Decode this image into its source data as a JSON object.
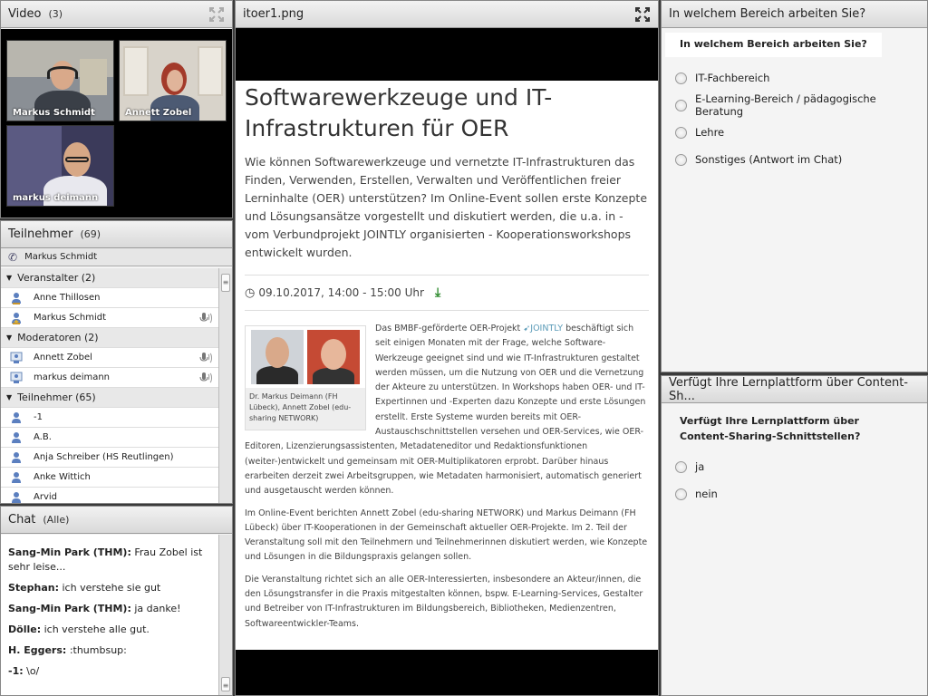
{
  "video": {
    "title": "Video",
    "count": "(3)",
    "tiles": [
      {
        "name": "Markus Schmidt"
      },
      {
        "name": "Annett Zobel"
      },
      {
        "name": "markus deimann"
      }
    ]
  },
  "participants": {
    "title": "Teilnehmer",
    "count": "(69)",
    "host": "Markus Schmidt",
    "rows": [
      {
        "type": "group",
        "label": "Veranstalter (2)"
      },
      {
        "type": "person",
        "label": "Anne Thillosen",
        "role": "host",
        "mic": false
      },
      {
        "type": "person",
        "label": "Markus Schmidt",
        "role": "host-star",
        "mic": true
      },
      {
        "type": "group",
        "label": "Moderatoren (2)"
      },
      {
        "type": "person",
        "label": "Annett Zobel",
        "role": "presenter",
        "mic": true
      },
      {
        "type": "person",
        "label": "markus deimann",
        "role": "presenter",
        "mic": true
      },
      {
        "type": "group",
        "label": "Teilnehmer (65)"
      },
      {
        "type": "person",
        "label": "-1",
        "role": "participant",
        "mic": false
      },
      {
        "type": "person",
        "label": "A.B.",
        "role": "participant",
        "mic": false
      },
      {
        "type": "person",
        "label": "Anja Schreiber (HS Reutlingen)",
        "role": "participant",
        "mic": false
      },
      {
        "type": "person",
        "label": "Anke Wittich",
        "role": "participant",
        "mic": false
      },
      {
        "type": "person",
        "label": "Arvid",
        "role": "participant",
        "mic": false
      }
    ]
  },
  "chat": {
    "title": "Chat",
    "scope": "(Alle)",
    "messages": [
      {
        "author": "Sang-Min Park (THM):",
        "text": "Frau Zobel ist sehr leise..."
      },
      {
        "author": "Stephan:",
        "text": "ich verstehe sie gut"
      },
      {
        "author": "Sang-Min Park (THM):",
        "text": "ja danke!"
      },
      {
        "author": "Dölle:",
        "text": "ich verstehe alle gut."
      },
      {
        "author": "H. Eggers:",
        "text": ":thumbsup:"
      },
      {
        "author": "-1:",
        "text": "\\o/"
      }
    ]
  },
  "share": {
    "filename": "itoer1.png",
    "title": "Softwarewerkzeuge und IT-Infrastrukturen für OER",
    "lead": "Wie können Softwarewerkzeuge und vernetzte IT-Infrastrukturen das Finden, Verwenden, Erstellen, Verwalten und Veröffentlichen freier Lerninhalte (OER) unterstützen? Im Online-Event sollen erste Konzepte und Lösungsansätze vorgestellt und diskutiert werden, die u.a. in - vom Verbundprojekt JOINTLY organisierten - Kooperationsworkshops entwickelt wurden.",
    "date": "09.10.2017, 14:00 - 15:00 Uhr",
    "photo_caption": "Dr. Markus Deimann (FH Lübeck), Annett Zobel (edu-sharing NETWORK)",
    "p1_a": "Das BMBF-geförderte OER-Projekt",
    "p1_logo": "JOINTLY",
    "p1_b": "beschäftigt sich seit einigen Monaten mit der Frage, welche Software-Werkzeuge geeignet sind und wie IT-Infrastrukturen gestaltet werden müssen, um die Nutzung von OER und die Vernetzung der Akteure zu unterstützen. In Workshops haben OER- und IT-Expertinnen und -Experten dazu Konzepte und erste Lösungen erstellt. Erste Systeme wurden bereits mit OER-Austauschschnittstellen versehen und OER-Services, wie OER-Editoren, Lizenzierungsassistenten, Metadateneditor und Redaktionsfunktionen (weiter-)entwickelt und gemeinsam mit OER-Multiplikatoren erprobt. Darüber hinaus erarbeiten derzeit zwei Arbeitsgruppen, wie Metadaten harmonisiert, automatisch generiert und ausgetauscht werden können.",
    "p2": "Im Online-Event berichten Annett Zobel (edu-sharing NETWORK) und Markus Deimann (FH Lübeck) über IT-Kooperationen in der Gemeinschaft aktueller OER-Projekte. Im 2. Teil der Veranstaltung soll mit den Teilnehmern und Teilnehmerinnen diskutiert werden, wie Konzepte und Lösungen in die Bildungspraxis gelangen sollen.",
    "p3": "Die Veranstaltung richtet sich an alle OER-Interessierten, insbesondere an Akteur/innen, die den Lösungstransfer in die Praxis mitgestalten können, bspw. E-Learning-Services, Gestalter und Betreiber von IT-Infrastrukturen im Bildungsbereich, Bibliotheken, Medienzentren, Softwareentwickler-Teams."
  },
  "poll1": {
    "header": "In welchem Bereich arbeiten Sie?",
    "question": "In welchem Bereich arbeiten Sie?",
    "options": [
      "IT-Fachbereich",
      "E-Learning-Bereich / pädagogische Beratung",
      "Lehre",
      "Sonstiges (Antwort im Chat)"
    ]
  },
  "poll2": {
    "header": "Verfügt Ihre Lernplattform über Content-Sh...",
    "question": "Verfügt Ihre Lernplattform über Content-Sharing-Schnittstellen?",
    "options": [
      "ja",
      "nein"
    ]
  },
  "colors": {
    "accent_green": "#2e8b2e",
    "jointly_blue": "#5b9bb8"
  }
}
